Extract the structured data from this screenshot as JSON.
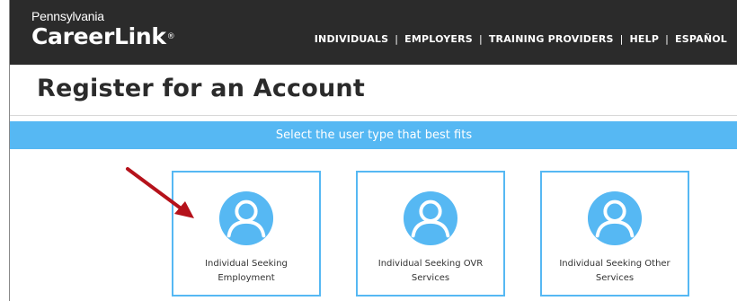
{
  "header": {
    "logo_state": "Pennsylvania",
    "logo_brand": "CareerLink",
    "logo_reg": "®",
    "nav": [
      "INDIVIDUALS",
      "EMPLOYERS",
      "TRAINING PROVIDERS",
      "HELP",
      "ESPAÑOL"
    ],
    "nav_separator": "|"
  },
  "page": {
    "title": "Register for an Account",
    "banner": "Select the user type that best fits"
  },
  "cards": [
    {
      "label": "Individual Seeking Employment",
      "icon": "user-icon"
    },
    {
      "label": "Individual Seeking OVR Services",
      "icon": "user-icon"
    },
    {
      "label": "Individual Seeking Other Services",
      "icon": "user-icon"
    }
  ],
  "annotation": {
    "icon": "arrow-icon",
    "color": "#b5121b"
  },
  "colors": {
    "header_bg": "#2b2b2b",
    "accent": "#56b8f3",
    "title_text": "#2b2b2b"
  }
}
